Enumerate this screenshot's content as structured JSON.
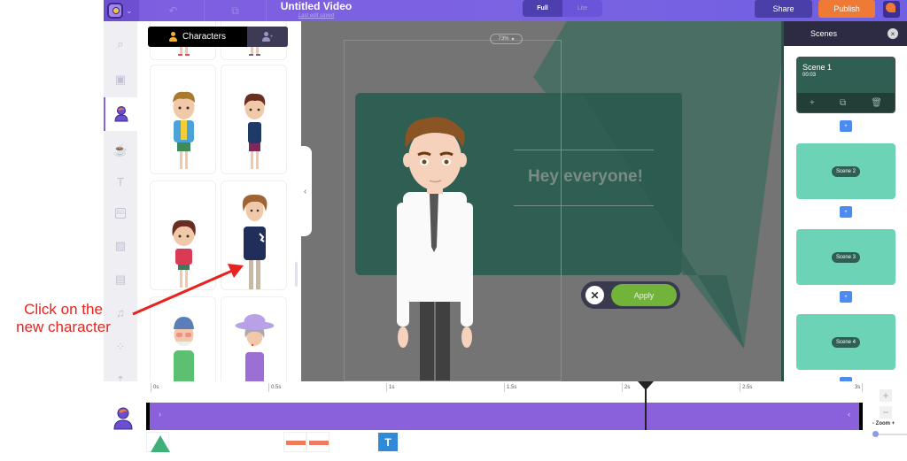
{
  "app": {
    "title": "Untitled Video",
    "save_status": "Last edit saved",
    "mode_options": [
      "Full",
      "Lite"
    ],
    "mode_selected": "Full",
    "share_label": "Share",
    "publish_label": "Publish"
  },
  "rail": {
    "items": [
      {
        "icon": "search-icon",
        "glyph": "⌕"
      },
      {
        "icon": "scene-icon",
        "glyph": "▣"
      },
      {
        "icon": "character-icon",
        "glyph": "",
        "active": true
      },
      {
        "icon": "props-cup-icon",
        "glyph": "☕"
      },
      {
        "icon": "text-icon",
        "glyph": "T"
      },
      {
        "icon": "background-icon",
        "glyph": "BG"
      },
      {
        "icon": "image-icon",
        "glyph": "▨"
      },
      {
        "icon": "video-icon",
        "glyph": "▤"
      },
      {
        "icon": "music-icon",
        "glyph": "♫"
      },
      {
        "icon": "effects-icon",
        "glyph": "⁘"
      },
      {
        "icon": "upload-icon",
        "glyph": "⇡"
      }
    ]
  },
  "panel": {
    "tab_characters": "Characters",
    "tab_custom_icon": "custom-character-icon",
    "characters": [
      {
        "name": "boy-blue-jacket"
      },
      {
        "name": "boy-tank-top"
      },
      {
        "name": "boy-red-shirt"
      },
      {
        "name": "curly-hair-man-navy-sweater"
      },
      {
        "name": "old-man-cap-green-sweater"
      },
      {
        "name": "old-woman-purple-hat"
      }
    ]
  },
  "canvas": {
    "zoom_level": "73%",
    "headline": "Hey everyone!",
    "cancel_label": "✕",
    "apply_label": "Apply",
    "colors": {
      "board": "#2f5e52",
      "triangle": "#4a6e64",
      "backdrop": "#747474"
    }
  },
  "scenes": {
    "title": "Scenes",
    "close_label": "×",
    "list": [
      {
        "name": "Scene 1",
        "duration": "00:03",
        "active": true
      },
      {
        "name": "Scene 2"
      },
      {
        "name": "Scene 3"
      },
      {
        "name": "Scene 4"
      }
    ],
    "actions": [
      "+",
      "⧉",
      "🗑"
    ],
    "add_label": "+"
  },
  "timeline": {
    "ticks": [
      "0s",
      "0.5s",
      "1s",
      "1.5s",
      "2s",
      "2.5s",
      "3s"
    ],
    "playhead_time_s": 2.1,
    "track_start_glyph": "›",
    "track_end_glyph": "‹",
    "zoom_in": "+",
    "zoom_out": "−",
    "zoom_label": "-  Zoom  +",
    "zoom_value": 0.0,
    "effects": [
      {
        "type": "enter-triangle",
        "color": "#3fb07a"
      },
      {
        "type": "motion",
        "color": "#ef7a5e"
      },
      {
        "type": "motion",
        "color": "#ef7a5e"
      },
      {
        "type": "text",
        "label": "T",
        "color": "#2f8bd8"
      }
    ]
  },
  "annotation": {
    "text_line1": "Click on the",
    "text_line2": "new character",
    "color": "#e8221f"
  }
}
